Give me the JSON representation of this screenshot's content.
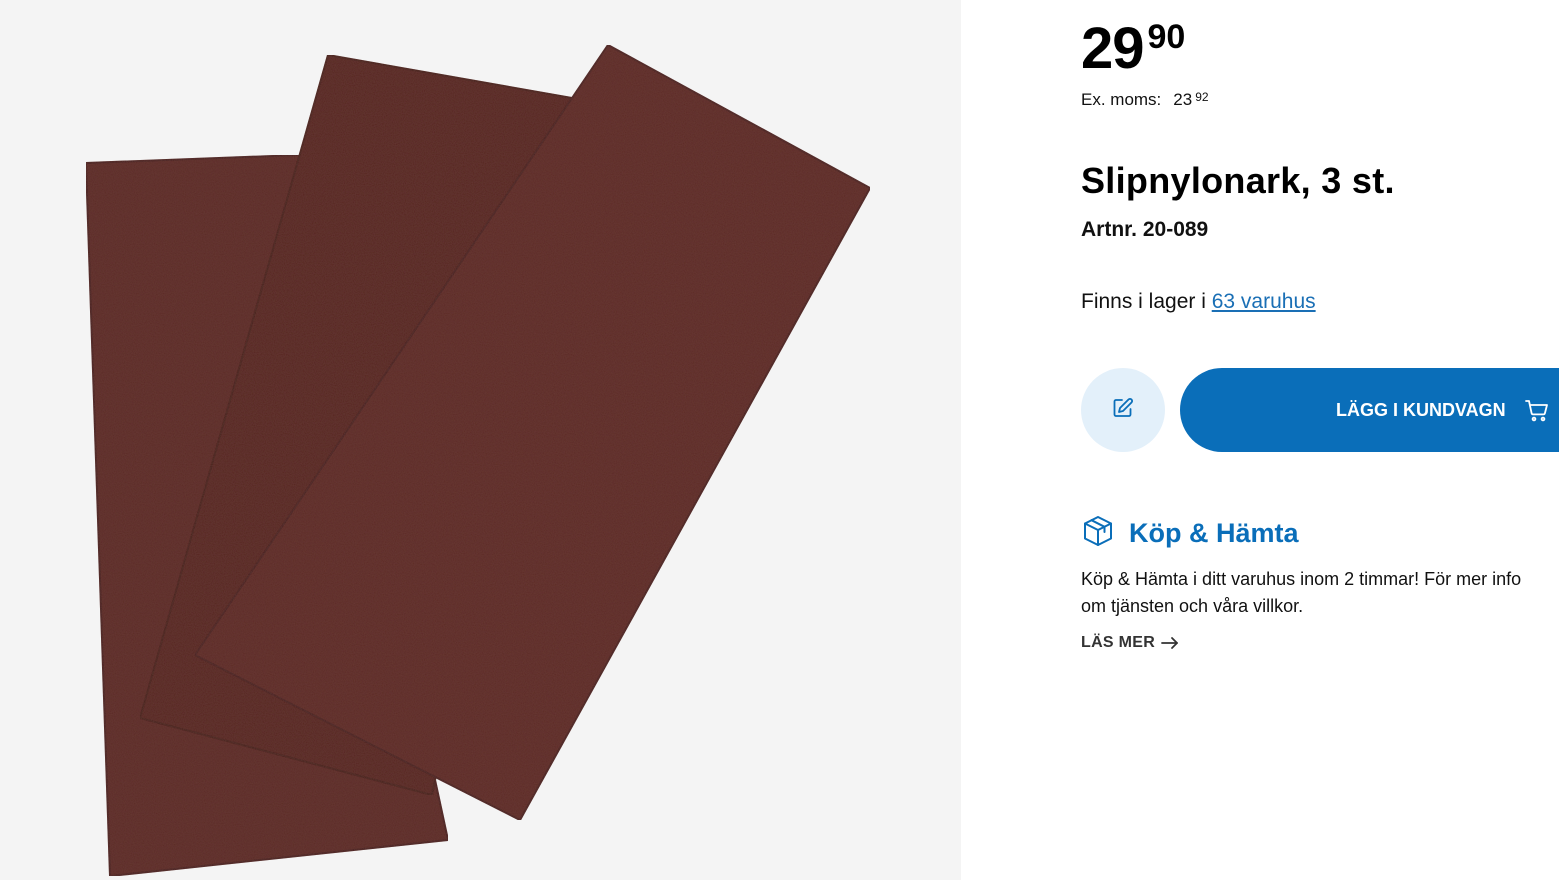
{
  "product_image": {
    "name": "product-image",
    "colors": {
      "background": "#f4f4f4",
      "pad": "#5a2a26",
      "pad_shadow": "#4a2220"
    }
  },
  "price": {
    "main": "29",
    "decimals": "90"
  },
  "ex_moms": {
    "label": "Ex. moms:",
    "main": "23",
    "decimals": "92"
  },
  "product": {
    "title": "Slipnylonark, 3 st.",
    "article_number": "Artnr. 20-089"
  },
  "stock": {
    "prefix": "Finns i lager i ",
    "link_text": "63 varuhus"
  },
  "actions": {
    "note_icon": "edit-icon",
    "add_to_cart_label": "LÄGG I KUNDVAGN",
    "cart_icon": "cart-icon"
  },
  "service": {
    "icon": "package-icon",
    "title": "Köp & Hämta",
    "text_line1": "Köp & Hämta i ditt varuhus inom 2 timmar! För mer info",
    "text_line2": "om tjänsten och våra villkor.",
    "read_more": "LÄS MER",
    "read_more_icon": "arrow-right-icon"
  },
  "colors": {
    "accent": "#0a6eb9",
    "link": "#1a6fb5",
    "note_button_bg": "#e3f0fa"
  }
}
